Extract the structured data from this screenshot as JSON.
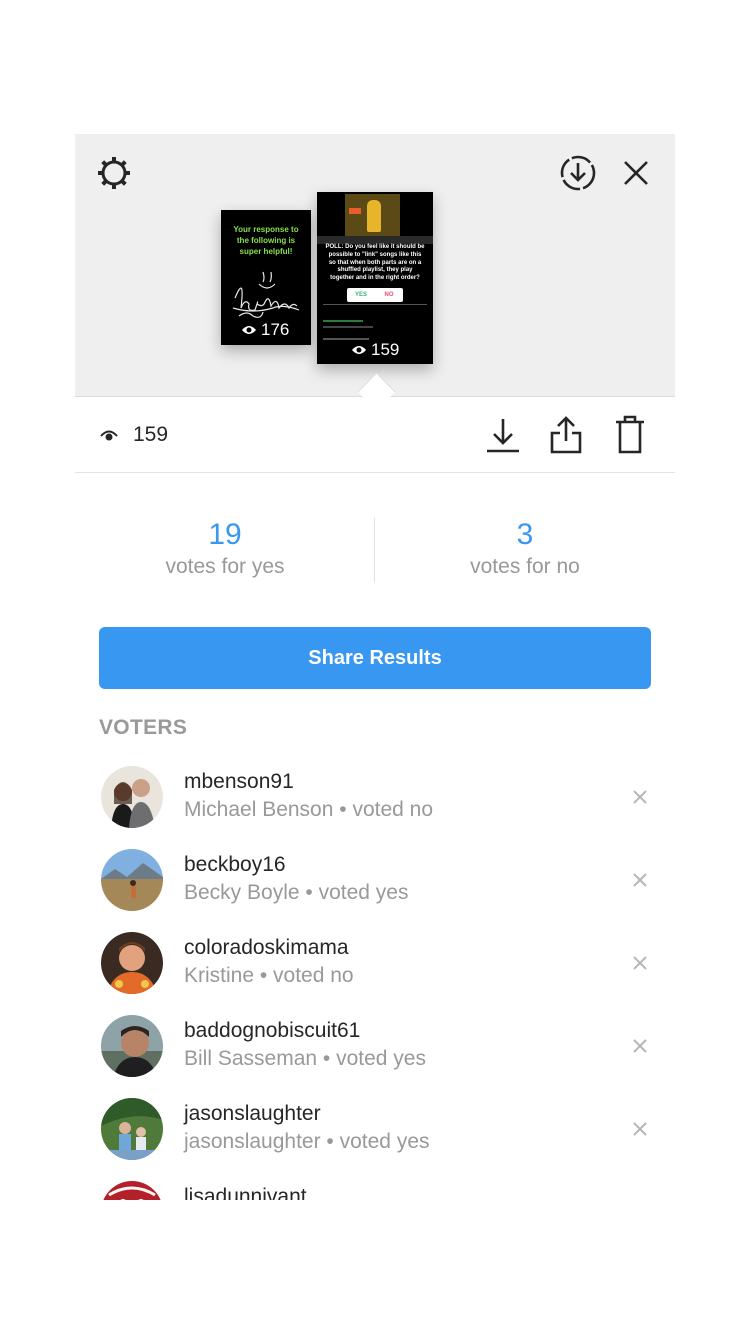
{
  "icons": {
    "settings": "gear-icon",
    "save_story": "download-circle-icon",
    "close": "close-icon",
    "eye": "eye-icon",
    "download": "download-icon",
    "share": "share-icon",
    "delete": "trash-icon",
    "remove": "x-icon"
  },
  "stories": [
    {
      "caption": "Your response to the following is super helpful!",
      "views": "176"
    },
    {
      "caption": "POLL: Do you feel like it should be possible to \"link\" songs like this so that when both parts are on a shuffled playlist, they play together and in the right order?",
      "poll_yes": "YES",
      "poll_no": "NO",
      "views": "159"
    }
  ],
  "stats": {
    "views": "159"
  },
  "votes": {
    "yes_count": "19",
    "yes_label": "votes for yes",
    "no_count": "3",
    "no_label": "votes for no"
  },
  "share_button": "Share Results",
  "voters_title": "VOTERS",
  "voters": [
    {
      "username": "mbenson91",
      "detail": "Michael Benson • voted no"
    },
    {
      "username": "beckboy16",
      "detail": "Becky Boyle • voted yes"
    },
    {
      "username": "coloradoskimama",
      "detail": "Kristine • voted no"
    },
    {
      "username": "baddognobiscuit61",
      "detail": "Bill Sasseman • voted yes"
    },
    {
      "username": "jasonslaughter",
      "detail": "jasonslaughter • voted yes"
    },
    {
      "username": "lisadunnivant",
      "detail": ""
    }
  ],
  "colors": {
    "accent": "#3897f0",
    "muted": "#999999",
    "header_bg": "#efefef"
  }
}
